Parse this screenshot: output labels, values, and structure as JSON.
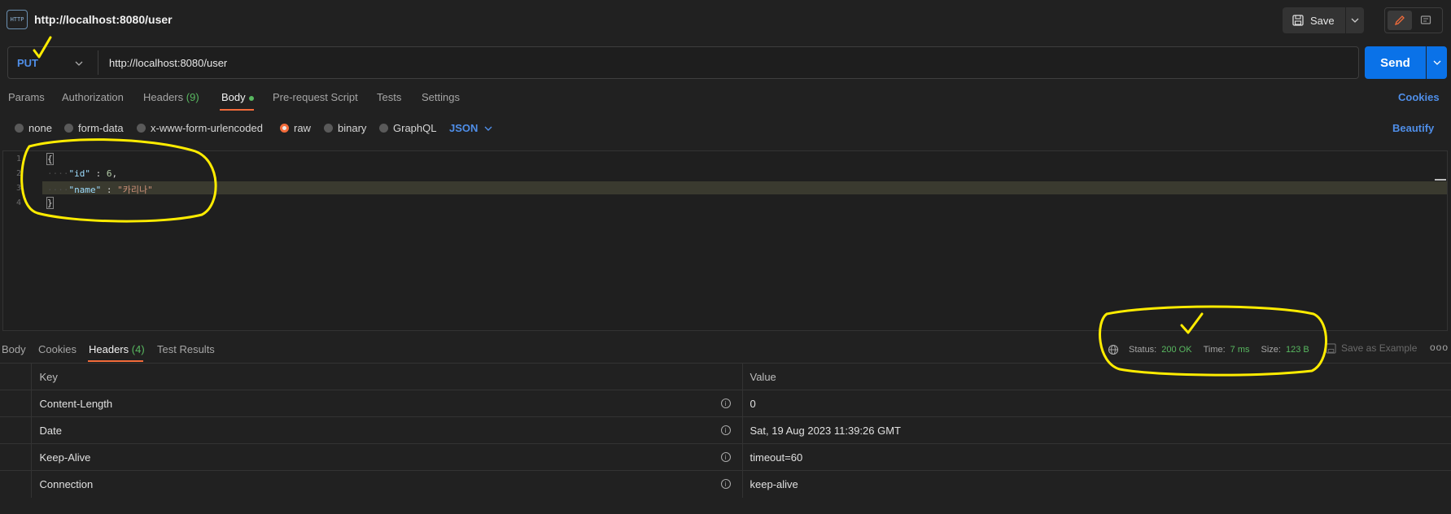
{
  "window": {
    "title": "http://localhost:8080/user",
    "icon": "http-icon",
    "icon_text": "HTTP"
  },
  "toolbar": {
    "save_label": "Save"
  },
  "request": {
    "method": "PUT",
    "url": "http://localhost:8080/user",
    "send_label": "Send"
  },
  "tabs": {
    "params": "Params",
    "authorization": "Authorization",
    "headers": "Headers",
    "headers_count": "(9)",
    "body": "Body",
    "prerequest": "Pre-request Script",
    "tests": "Tests",
    "settings": "Settings",
    "cookies": "Cookies"
  },
  "body_types": {
    "none": "none",
    "form_data": "form-data",
    "urlencoded": "x-www-form-urlencoded",
    "raw": "raw",
    "binary": "binary",
    "graphql": "GraphQL",
    "language": "JSON",
    "beautify": "Beautify",
    "selected": "raw"
  },
  "editor": {
    "line_numbers": [
      "1",
      "2",
      "3",
      "4"
    ],
    "open_brace": "{",
    "close_brace": "}",
    "id_key": "\"id\"",
    "id_value": "6",
    "name_key": "\"name\"",
    "name_value": "\"카리나\""
  },
  "response": {
    "tabs": {
      "body": "Body",
      "cookies": "Cookies",
      "headers": "Headers",
      "headers_count": "(4)",
      "test_results": "Test Results"
    },
    "status_label": "Status:",
    "status_value": "200 OK",
    "time_label": "Time:",
    "time_value": "7 ms",
    "size_label": "Size:",
    "size_value": "123 B",
    "save_example": "Save as Example",
    "more": "ooo",
    "columns": {
      "key": "Key",
      "value": "Value"
    },
    "headers": [
      {
        "key": "Content-Length",
        "value": "0"
      },
      {
        "key": "Date",
        "value": "Sat, 19 Aug 2023 11:39:26 GMT"
      },
      {
        "key": "Keep-Alive",
        "value": "timeout=60"
      },
      {
        "key": "Connection",
        "value": "keep-alive"
      }
    ]
  },
  "colors": {
    "accent": "#f26b3a",
    "link": "#4f8ee8",
    "send": "#0a72e8",
    "success": "#58b860",
    "annotation": "#ffec00"
  }
}
